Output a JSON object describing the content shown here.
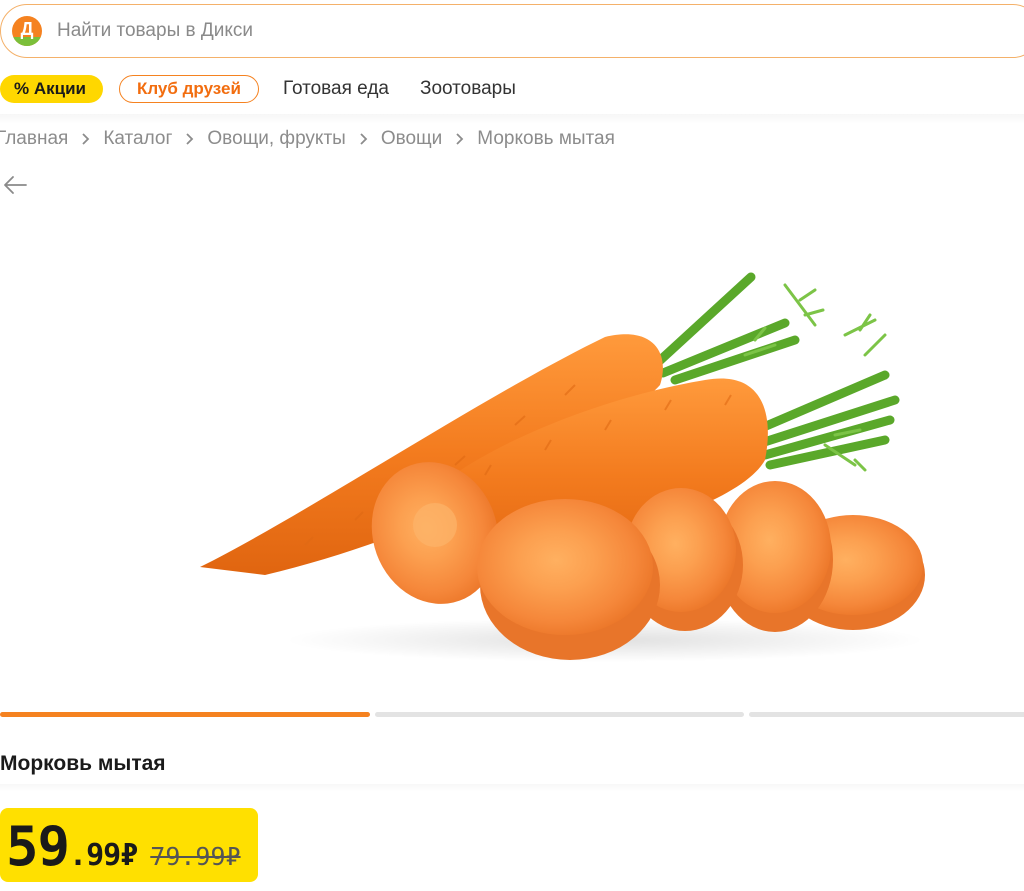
{
  "search": {
    "placeholder": "Найти товары в Дикси",
    "logo_letter": "Д"
  },
  "nav": {
    "promo": "% Акции",
    "club": "Клуб друзей",
    "links": [
      "Готовая еда",
      "Зоотовары"
    ]
  },
  "breadcrumb": [
    "Главная",
    "Каталог",
    "Овощи, фрукты",
    "Овощи",
    "Морковь мытая"
  ],
  "icons": {
    "back": "arrow-left-icon",
    "chevron": "chevron-right-icon",
    "logo": "dixy-logo-icon"
  },
  "carousel": {
    "slides": 3,
    "active": 1
  },
  "product": {
    "title": "Морковь мытая",
    "price_int": "59",
    "price_frac": ".99",
    "currency": "₽",
    "old_price": "79.99₽"
  },
  "colors": {
    "brand_orange": "#f58220",
    "promo_yellow": "#ffd700",
    "price_yellow": "#ffe000",
    "logo_green": "#7bbf3a"
  }
}
